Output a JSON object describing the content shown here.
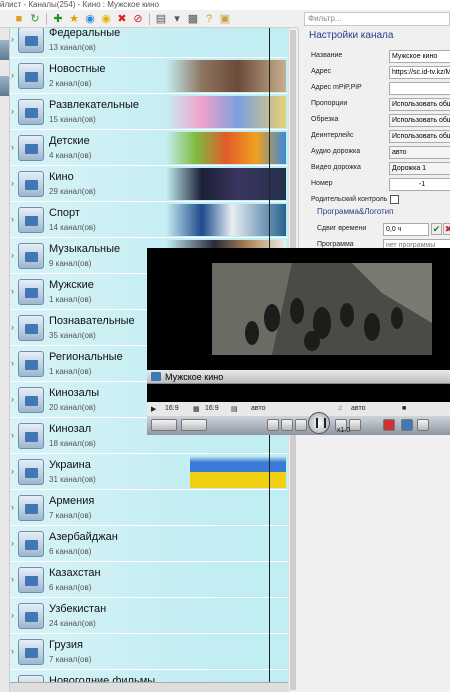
{
  "window": {
    "title": "йлист - Каналы(254) - Кино : Мужское кино"
  },
  "toolbar": {
    "icons": [
      "folder-open-icon",
      "refresh-icon",
      "add-icon",
      "star-icon",
      "record-icon",
      "ok-icon",
      "delete-icon",
      "block-icon",
      "list-icon",
      "list-dropdown-icon",
      "view-icon",
      "help-icon",
      "lock-icon"
    ]
  },
  "filter": {
    "placeholder": "Фильтр..."
  },
  "groups": [
    {
      "name": "Федеральные",
      "count": "13 канал(ов)"
    },
    {
      "name": "Новостные",
      "count": "2 канал(ов)"
    },
    {
      "name": "Развлекательные",
      "count": "15 канал(ов)"
    },
    {
      "name": "Детские",
      "count": "4 канал(ов)"
    },
    {
      "name": "Кино",
      "count": "29 канал(ов)"
    },
    {
      "name": "Спорт",
      "count": "14 канал(ов)"
    },
    {
      "name": "Музыкальные",
      "count": "9 канал(ов)"
    },
    {
      "name": "Мужские",
      "count": "1 канал(ов)"
    },
    {
      "name": "Познавательные",
      "count": "35 канал(ов)"
    },
    {
      "name": "Региональные",
      "count": "1 канал(ов)"
    },
    {
      "name": "Кинозалы",
      "count": "20 канал(ов)"
    },
    {
      "name": "Кинозал",
      "count": "18 канал(ов)"
    },
    {
      "name": "Украина",
      "count": "31 канал(ов)"
    },
    {
      "name": "Армения",
      "count": "7 канал(ов)"
    },
    {
      "name": "Азербайджан",
      "count": "6 канал(ов)"
    },
    {
      "name": "Казахстан",
      "count": "6 канал(ов)"
    },
    {
      "name": "Узбекистан",
      "count": "24 канал(ов)"
    },
    {
      "name": "Грузия",
      "count": "7 канал(ов)"
    },
    {
      "name": "Новогодние фильмы",
      "count": ""
    }
  ],
  "settings": {
    "title": "Настройки канала",
    "name_label": "Название",
    "name_value": "Мужское кино",
    "address_label": "Адрес",
    "address_value": "https://sc.id-tv.kz/M",
    "pip_label": "Адрес mPiP,PiP",
    "pip_value": "",
    "aspect_label": "Пропорции",
    "aspect_value": "Использовать общ",
    "crop_label": "Обрезка",
    "crop_value": "Использовать общ",
    "deint_label": "Деинтерлейс",
    "deint_value": "Использовать общ",
    "audio_label": "Аудио дорожка",
    "audio_value": "авто",
    "video_label": "Видео дорожка",
    "video_value": "Дорожка 1",
    "number_label": "Номер",
    "number_value": "-1",
    "parental_label": "Родительский контроль",
    "program_link": "Программа&Логотип",
    "shift_label": "Сдвиг времени",
    "shift_value": "0,0 ч",
    "program_label": "Программа",
    "program_value": "нет программы"
  },
  "player": {
    "title": "Мужское кино",
    "aspect1": "16:9",
    "aspect2": "16:9",
    "mode": "авто",
    "audio": "авто",
    "speed": "x1.0"
  }
}
